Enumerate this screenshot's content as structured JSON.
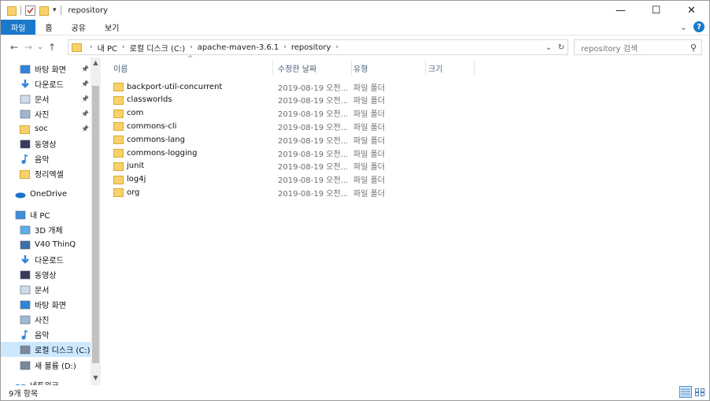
{
  "window": {
    "title": "repository"
  },
  "window_controls": {
    "minimize": "—",
    "maximize": "☐",
    "close": "✕"
  },
  "ribbon": {
    "tabs": [
      {
        "label": "파일"
      },
      {
        "label": "홈"
      },
      {
        "label": "공유"
      },
      {
        "label": "보기"
      }
    ],
    "collapse": "⌄",
    "help": "?"
  },
  "address": {
    "crumbs": [
      "내 PC",
      "로컬 디스크 (C:)",
      "apache-maven-3.6.1",
      "repository"
    ],
    "refresh": "↻",
    "dropdown": "⌄"
  },
  "search": {
    "placeholder": "repository 검색"
  },
  "sidebar": {
    "items": [
      {
        "label": "바탕 화면",
        "icon": "desktop-icon",
        "pinned": true
      },
      {
        "label": "다운로드",
        "icon": "download-icon",
        "pinned": true
      },
      {
        "label": "문서",
        "icon": "document-icon",
        "pinned": true
      },
      {
        "label": "사진",
        "icon": "pictures-icon",
        "pinned": true
      },
      {
        "label": "soc",
        "icon": "folder-icon",
        "pinned": true
      },
      {
        "label": "동영상",
        "icon": "video-icon",
        "pinned": false
      },
      {
        "label": "음악",
        "icon": "music-icon",
        "pinned": false
      },
      {
        "label": "정리엑셀",
        "icon": "folder-icon",
        "pinned": false
      },
      {
        "label": "OneDrive",
        "icon": "onedrive-icon",
        "pinned": false
      },
      {
        "label": "내 PC",
        "icon": "pc-icon",
        "pinned": false
      },
      {
        "label": "3D 개체",
        "icon": "3d-objects-icon",
        "pinned": false
      },
      {
        "label": "V40 ThinQ",
        "icon": "phone-icon",
        "pinned": false
      },
      {
        "label": "다운로드",
        "icon": "download-icon",
        "pinned": false
      },
      {
        "label": "동영상",
        "icon": "video-icon",
        "pinned": false
      },
      {
        "label": "문서",
        "icon": "document-icon",
        "pinned": false
      },
      {
        "label": "바탕 화면",
        "icon": "desktop-icon",
        "pinned": false
      },
      {
        "label": "사진",
        "icon": "pictures-icon",
        "pinned": false
      },
      {
        "label": "음악",
        "icon": "music-icon",
        "pinned": false
      },
      {
        "label": "로컬 디스크 (C:)",
        "icon": "drive-c-icon",
        "pinned": false,
        "selected": true
      },
      {
        "label": "새 볼륨 (D:)",
        "icon": "drive-icon",
        "pinned": false
      },
      {
        "label": "네트워크",
        "icon": "network-icon",
        "pinned": false
      }
    ]
  },
  "columns": [
    {
      "label": "이름"
    },
    {
      "label": "수정한 날짜"
    },
    {
      "label": "유형"
    },
    {
      "label": "크기"
    }
  ],
  "files": [
    {
      "name": "backport-util-concurrent",
      "date": "2019-08-19 오전...",
      "type": "파일 폴더"
    },
    {
      "name": "classworlds",
      "date": "2019-08-19 오전...",
      "type": "파일 폴더"
    },
    {
      "name": "com",
      "date": "2019-08-19 오전...",
      "type": "파일 폴더"
    },
    {
      "name": "commons-cli",
      "date": "2019-08-19 오전...",
      "type": "파일 폴더"
    },
    {
      "name": "commons-lang",
      "date": "2019-08-19 오전...",
      "type": "파일 폴더"
    },
    {
      "name": "commons-logging",
      "date": "2019-08-19 오전...",
      "type": "파일 폴더"
    },
    {
      "name": "junit",
      "date": "2019-08-19 오전...",
      "type": "파일 폴더"
    },
    {
      "name": "log4j",
      "date": "2019-08-19 오전...",
      "type": "파일 폴더"
    },
    {
      "name": "org",
      "date": "2019-08-19 오전...",
      "type": "파일 폴더"
    }
  ],
  "status": {
    "item_count": "9개 항목"
  },
  "colors": {
    "accent": "#1979ca",
    "folder": "#f7d26a",
    "selected": "#cce8ff"
  }
}
